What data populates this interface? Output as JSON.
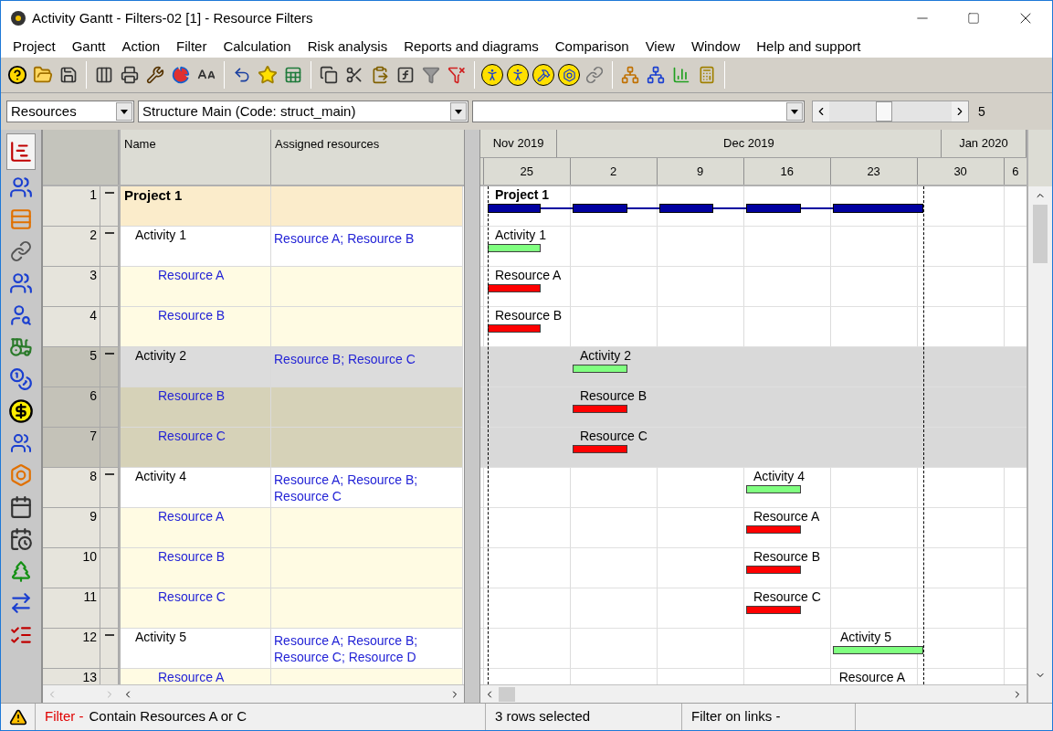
{
  "window": {
    "title": "Activity Gantt - Filters-02 [1] - Resource Filters"
  },
  "menu": [
    "Project",
    "Gantt",
    "Action",
    "Filter",
    "Calculation",
    "Risk analysis",
    "Reports and diagrams",
    "Comparison",
    "View",
    "Window",
    "Help and support"
  ],
  "selectors": {
    "view": "Resources",
    "structure": "Structure Main (Code: struct_main)",
    "zoom": {
      "level": 0.45,
      "reading": "5"
    }
  },
  "columns": [
    "Name",
    "Assigned resources"
  ],
  "rows": [
    {
      "number": "1",
      "kind": "project",
      "name": "Project 1",
      "assigned": "",
      "expanded": true,
      "selected": false,
      "bar_label": "Project 1"
    },
    {
      "number": "2",
      "kind": "activity",
      "name": "Activity 1",
      "assigned": "Resource A; Resource B",
      "expanded": true,
      "selected": false,
      "bar_label": "Activity 1"
    },
    {
      "number": "3",
      "kind": "resource",
      "name": "Resource A",
      "selected": false,
      "bar_label": "Resource A"
    },
    {
      "number": "4",
      "kind": "resource",
      "name": "Resource B",
      "selected": false,
      "bar_label": "Resource B"
    },
    {
      "number": "5",
      "kind": "activity",
      "name": "Activity 2",
      "assigned": "Resource B; Resource C",
      "expanded": true,
      "selected": true,
      "bar_label": "Activity 2"
    },
    {
      "number": "6",
      "kind": "resource",
      "name": "Resource B",
      "selected": true,
      "bar_label": "Resource B"
    },
    {
      "number": "7",
      "kind": "resource",
      "name": "Resource C",
      "selected": true,
      "bar_label": "Resource C"
    },
    {
      "number": "8",
      "kind": "activity",
      "name": "Activity 4",
      "assigned": "Resource A; Resource B; Resource C",
      "expanded": true,
      "selected": false,
      "bar_label": "Activity 4"
    },
    {
      "number": "9",
      "kind": "resource",
      "name": "Resource A",
      "selected": false,
      "bar_label": "Resource A"
    },
    {
      "number": "10",
      "kind": "resource",
      "name": "Resource B",
      "selected": false,
      "bar_label": "Resource B"
    },
    {
      "number": "11",
      "kind": "resource",
      "name": "Resource C",
      "selected": false,
      "bar_label": "Resource C"
    },
    {
      "number": "12",
      "kind": "activity",
      "name": "Activity 5",
      "assigned": "Resource A; Resource B; Resource C; Resource D",
      "expanded": true,
      "selected": false,
      "bar_label": "Activity 5"
    },
    {
      "number": "13",
      "kind": "resource",
      "name": "Resource A",
      "selected": false,
      "bar_label": "Resource A"
    }
  ],
  "timeline": {
    "months": [
      "Nov 2019",
      "Dec 2019",
      "Jan 2020"
    ],
    "weeks": [
      "25",
      "2",
      "9",
      "16",
      "23",
      "30",
      "6"
    ]
  },
  "status_bar": {
    "filter_label": "Filter -",
    "filter": "Contain Resources A or C",
    "selection": "3 rows selected",
    "links": "Filter on links -"
  }
}
